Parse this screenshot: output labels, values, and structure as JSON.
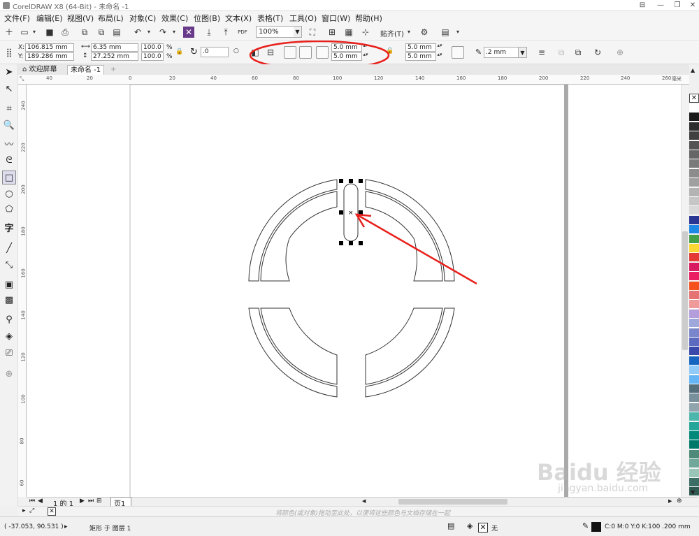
{
  "app": {
    "title": "CorelDRAW X8 (64-Bit) - 未命名 -1",
    "minimize": "—",
    "restore": "❐",
    "close": "✕",
    "extra_icon": "⊟"
  },
  "menu": [
    "文件(F)",
    "编辑(E)",
    "视图(V)",
    "布局(L)",
    "对象(C)",
    "效果(C)",
    "位图(B)",
    "文本(X)",
    "表格(T)",
    "工具(O)",
    "窗口(W)",
    "帮助(H)"
  ],
  "toolbar": {
    "zoom": "100%",
    "pdf_label": "PDF",
    "snap_label": "贴齐(T)"
  },
  "propbar": {
    "x_label": "X:",
    "x_value": "106.815 mm",
    "y_label": "Y:",
    "y_value": "189.286 mm",
    "w_value": "6.35 mm",
    "h_value": "27.252 mm",
    "sx_value": "100.0",
    "sy_value": "100.0",
    "pct": "%",
    "rotate_value": ".0",
    "corner_radius_1": "5.0 mm",
    "corner_radius_2": "5.0 mm",
    "corner_radius_3": "5.0 mm",
    "corner_radius_4": "5.0 mm",
    "outline_width": ".2 mm"
  },
  "doctabs": {
    "welcome": "欢迎屏幕",
    "doc": "未命名 -1",
    "add": "+"
  },
  "ruler": {
    "h_ticks": [
      "40",
      "20",
      "0",
      "20",
      "40",
      "60",
      "80",
      "100",
      "120",
      "140",
      "160",
      "180",
      "200",
      "220",
      "240",
      "260"
    ],
    "v_ticks": [
      "240",
      "220",
      "200",
      "180",
      "160",
      "140",
      "120",
      "100",
      "80",
      "60"
    ],
    "unit": "毫米"
  },
  "pagenav": {
    "page_of": "1 的 1",
    "page_tab": "页1"
  },
  "docpalette": {
    "hint": "将颜色(或对象)拖动至此处，以便将这些颜色与文档存储在一起"
  },
  "status": {
    "coords": "( -37.053, 90.531 )",
    "object_info": "矩形 于 图层 1",
    "fill_none": "无",
    "color_info": "C:0 M:0 Y:0 K:100  .200 mm"
  },
  "palette_colors": [
    "#ffffff",
    "#1a1a1a",
    "#2d2d2d",
    "#404040",
    "#535353",
    "#666666",
    "#7a7a7a",
    "#8c8c8c",
    "#a0a0a0",
    "#b3b3b3",
    "#c6c6c6",
    "#d9d9d9",
    "#283593",
    "#1e88e5",
    "#43a047",
    "#fdd835",
    "#e53935",
    "#d81b60",
    "#e91e63",
    "#f4511e",
    "#e57373",
    "#ef9a9a",
    "#b39ddb",
    "#9fa8da",
    "#7986cb",
    "#5c6bc0",
    "#3949ab",
    "#1565c0",
    "#90caf9",
    "#64b5f6",
    "#546e7a",
    "#78909c",
    "#90a4ae",
    "#4db6ac",
    "#26a69a",
    "#00897b",
    "#00796b",
    "#4e8a7a",
    "#6fa89a",
    "#99c4b8",
    "#3c6e66",
    "#2e5a52"
  ],
  "watermark": {
    "line1": "Baidu 经验",
    "line2": "jingyan.baidu.com"
  }
}
